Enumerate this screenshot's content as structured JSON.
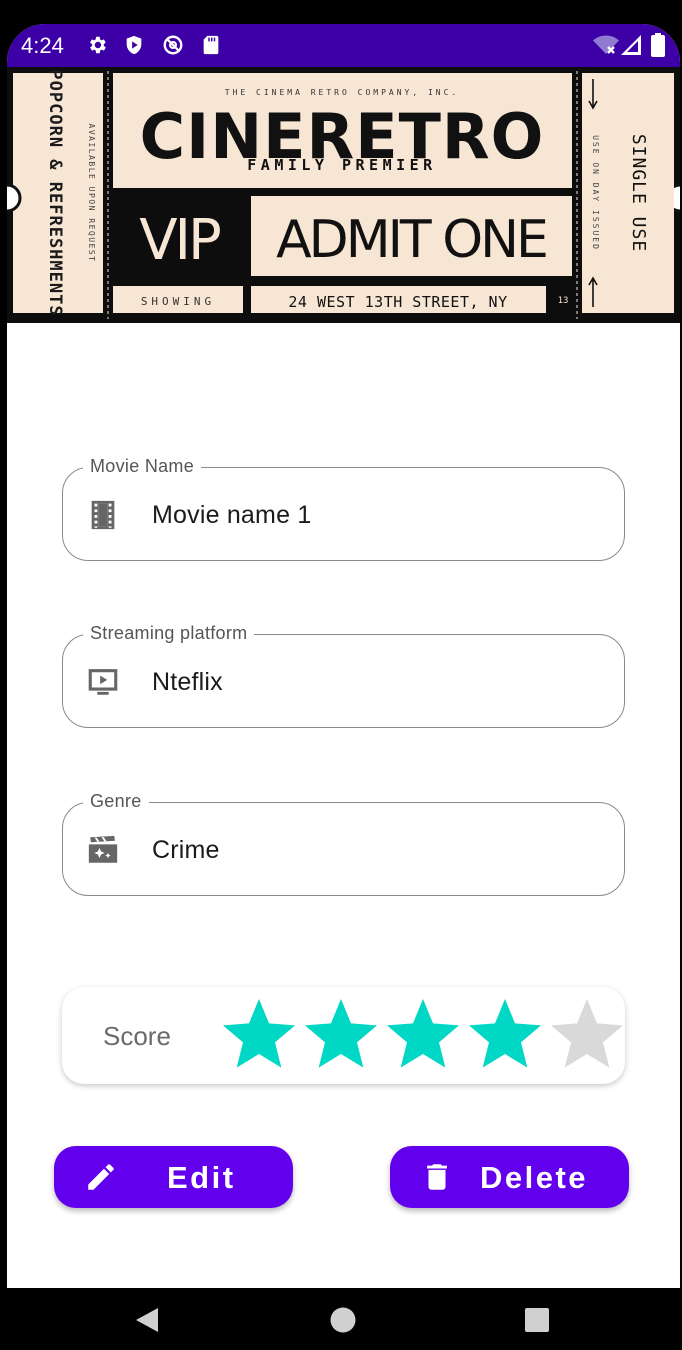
{
  "status_bar": {
    "time": "4:24",
    "icons": [
      "gear-icon",
      "shield-icon",
      "at-sign-icon",
      "sd-card-icon"
    ],
    "right_icons": [
      "wifi-off-icon",
      "signal-icon",
      "battery-icon"
    ],
    "background": "#3d00a6"
  },
  "ticket": {
    "company": "THE CINEMA RETRO COMPANY, INC.",
    "title": "CINERETRO",
    "subtitle": "FAMILY PREMIER",
    "left_stub_main": "POPCORN & REFRESHMENTS",
    "left_stub_small": "AVAILABLE UPON REQUEST",
    "vip": "VIP",
    "admit": "ADMIT ONE",
    "showing": "SHOWING",
    "address": "24 WEST 13TH STREET, NY",
    "number": "13",
    "right_stub_main": "SINGLE USE",
    "right_stub_small": "USE ON DAY ISSUED",
    "paper_color": "#f7e6d4"
  },
  "movie_name": {
    "label": "Movie Name",
    "value": "Movie name 1",
    "icon": "film-strip-icon"
  },
  "streaming_platform": {
    "label": "Streaming platform",
    "value": "Nteflix",
    "icon": "tv-play-icon"
  },
  "genre": {
    "label": "Genre",
    "value": "Crime",
    "icon": "clapperboard-sparkle-icon"
  },
  "score": {
    "label": "Score",
    "rating": 4,
    "max": 5,
    "filled_color": "#00d7c4",
    "empty_color": "#d9d9d9"
  },
  "actions": {
    "edit": {
      "label": "Edit",
      "icon": "pencil-icon"
    },
    "delete": {
      "label": "Delete",
      "icon": "trash-icon"
    },
    "color": "#6200ee"
  },
  "nav_bar": {
    "buttons": [
      "back-icon",
      "home-icon",
      "recents-icon"
    ]
  }
}
